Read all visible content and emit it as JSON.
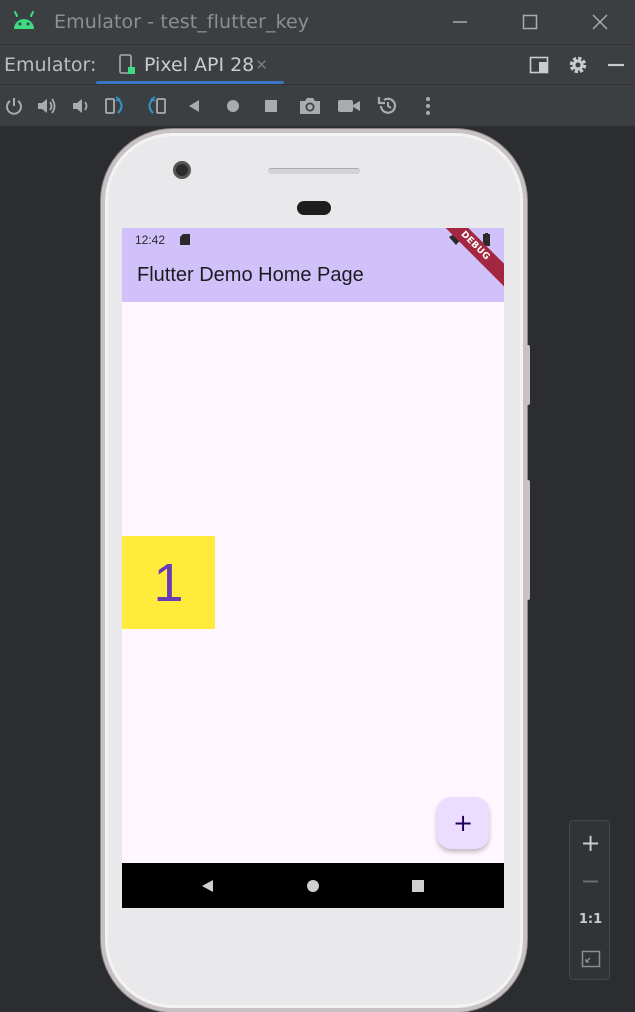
{
  "window": {
    "title": "Emulator - test_flutter_key",
    "buttons": [
      "minimize",
      "maximize",
      "close"
    ]
  },
  "tabbar": {
    "label": "Emulator:",
    "active_tab": "Pixel API 28",
    "tab_close": "×"
  },
  "toolbar": {
    "tools": [
      "power-icon",
      "volume-up-icon",
      "volume-down-icon",
      "rotate-left-icon",
      "rotate-right-icon",
      "back-icon",
      "home-icon",
      "overview-icon",
      "screenshot-icon",
      "screen-record-icon",
      "snapshot-restore-icon",
      "more-icon"
    ]
  },
  "phone": {
    "status_time": "12:42",
    "app_title": "Flutter Demo Home Page",
    "debug_banner": "DEBUG",
    "counter_value": "1",
    "fab_label": "+"
  },
  "zoom": {
    "zoom_in": "+",
    "zoom_out": "−",
    "actual_size": "1:1"
  },
  "colors": {
    "appbar": "#d1c1fb",
    "screen_bg": "#fef7ff",
    "counter_box": "#ffeb3b",
    "counter_text": "#673ab7",
    "fab_bg": "#eaddff",
    "tab_underline": "#3a76c3",
    "debug_banner": "#a3283f"
  }
}
